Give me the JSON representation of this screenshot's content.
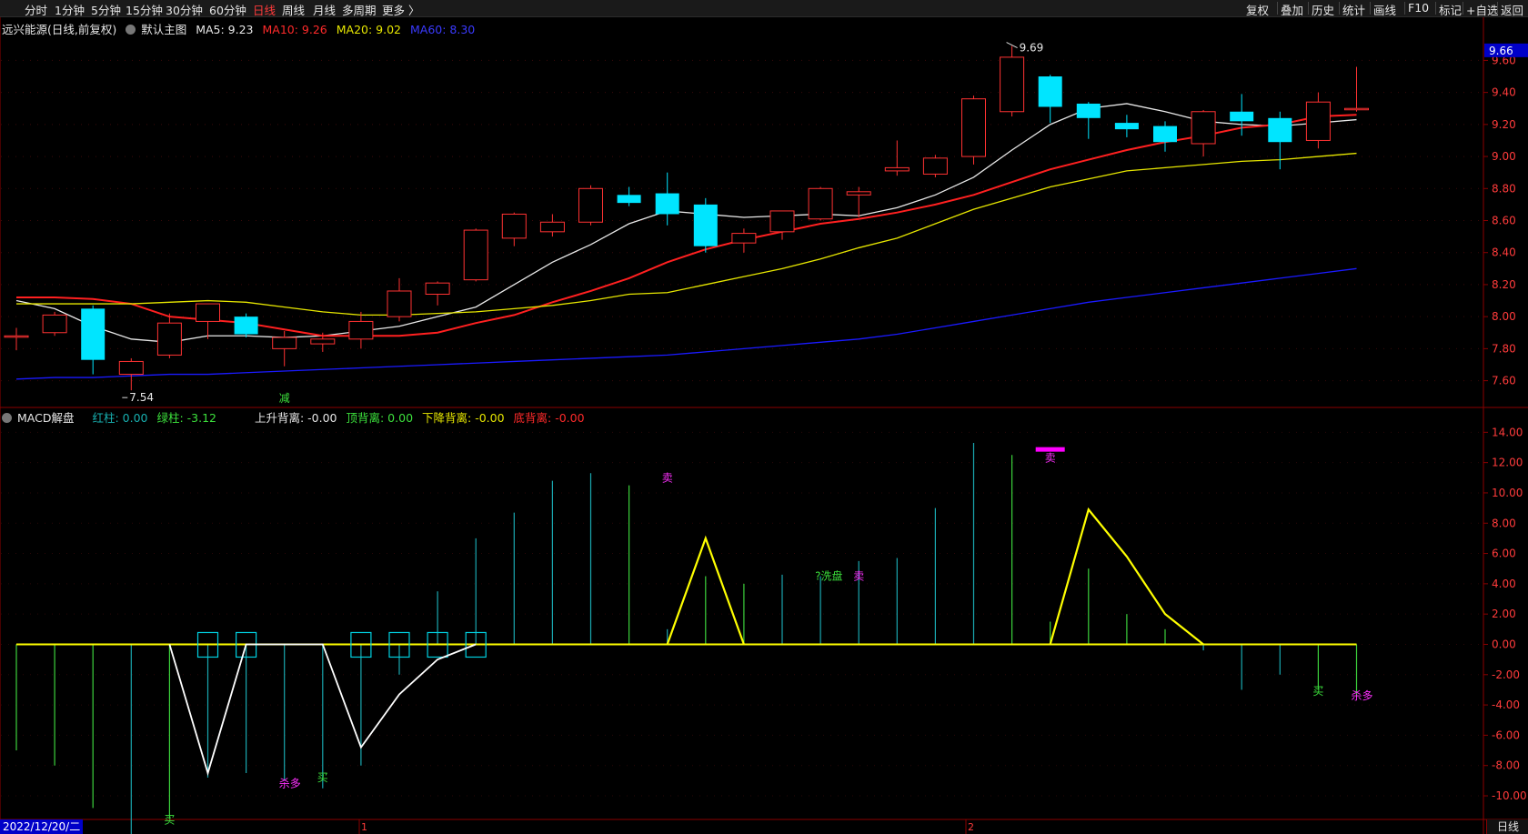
{
  "toolbar": {
    "left_items": [
      "分时",
      "1分钟",
      "5分钟",
      "15分钟",
      "30分钟",
      "60分钟",
      "日线",
      "周线",
      "月线",
      "多周期",
      "更多 〉"
    ],
    "active": "日线",
    "right_items": [
      "复权",
      "叠加",
      "历史",
      "统计",
      "画线",
      "F10",
      "标记",
      "+自选",
      "返回"
    ]
  },
  "main_panel": {
    "stock_title": "远兴能源(日线,前复权)",
    "chart_name": "默认主图",
    "ma5": "MA5: 9.23",
    "ma10": "MA10: 9.26",
    "ma20": "MA20: 9.02",
    "ma60": "MA60: 8.30",
    "price_tag": "9.66",
    "high_label": "9.69",
    "low_label": "7.54",
    "reduce_label": "减",
    "y_ticks": [
      "9.60",
      "9.40",
      "9.20",
      "9.00",
      "8.80",
      "8.60",
      "8.40",
      "8.20",
      "8.00",
      "7.80",
      "7.60"
    ]
  },
  "sub_panel": {
    "name": "MACD解盘",
    "red_bar": "红柱: 0.00",
    "green_bar": "绿柱: -3.12",
    "rise_div": "上升背离: -0.00",
    "top_div": "顶背离: 0.00",
    "fall_div": "下降背离: -0.00",
    "bottom_div": "底背离: -0.00",
    "y_ticks": [
      "14.00",
      "12.00",
      "10.00",
      "8.00",
      "6.00",
      "4.00",
      "2.00",
      "0.00",
      "-2.00",
      "-4.00",
      "-6.00",
      "-8.00",
      "-10.00"
    ],
    "signals": [
      "买",
      "杀多",
      "买",
      "卖",
      "?洗盘",
      "卖",
      "卖",
      "买",
      "杀多"
    ]
  },
  "x_axis": {
    "date": "2022/12/20/二",
    "marks": [
      "1",
      "2"
    ]
  },
  "period_label": "日线",
  "chart_data": [
    {
      "type": "candlestick",
      "title": "远兴能源(日线,前复权)",
      "ylim": [
        7.45,
        9.75
      ],
      "candles": [
        {
          "o": 7.88,
          "h": 7.93,
          "l": 7.79,
          "c": 7.88
        },
        {
          "o": 7.9,
          "h": 8.03,
          "l": 7.88,
          "c": 8.01
        },
        {
          "o": 8.05,
          "h": 8.07,
          "l": 7.64,
          "c": 7.73
        },
        {
          "o": 7.64,
          "h": 7.74,
          "l": 7.54,
          "c": 7.72
        },
        {
          "o": 7.76,
          "h": 8.02,
          "l": 7.74,
          "c": 7.96
        },
        {
          "o": 7.97,
          "h": 8.06,
          "l": 7.86,
          "c": 8.08
        },
        {
          "o": 8.0,
          "h": 8.02,
          "l": 7.87,
          "c": 7.89
        },
        {
          "o": 7.8,
          "h": 7.91,
          "l": 7.69,
          "c": 7.87
        },
        {
          "o": 7.83,
          "h": 7.9,
          "l": 7.78,
          "c": 7.86
        },
        {
          "o": 7.86,
          "h": 8.03,
          "l": 7.8,
          "c": 7.97
        },
        {
          "o": 8.0,
          "h": 8.24,
          "l": 7.97,
          "c": 8.16
        },
        {
          "o": 8.14,
          "h": 8.22,
          "l": 8.07,
          "c": 8.21
        },
        {
          "o": 8.23,
          "h": 8.55,
          "l": 8.22,
          "c": 8.54
        },
        {
          "o": 8.49,
          "h": 8.65,
          "l": 8.44,
          "c": 8.64
        },
        {
          "o": 8.53,
          "h": 8.64,
          "l": 8.5,
          "c": 8.59
        },
        {
          "o": 8.59,
          "h": 8.82,
          "l": 8.57,
          "c": 8.8
        },
        {
          "o": 8.76,
          "h": 8.81,
          "l": 8.69,
          "c": 8.71
        },
        {
          "o": 8.77,
          "h": 8.9,
          "l": 8.57,
          "c": 8.64
        },
        {
          "o": 8.7,
          "h": 8.74,
          "l": 8.4,
          "c": 8.44
        },
        {
          "o": 8.46,
          "h": 8.55,
          "l": 8.4,
          "c": 8.52
        },
        {
          "o": 8.53,
          "h": 8.66,
          "l": 8.48,
          "c": 8.66
        },
        {
          "o": 8.61,
          "h": 8.81,
          "l": 8.6,
          "c": 8.8
        },
        {
          "o": 8.76,
          "h": 8.81,
          "l": 8.62,
          "c": 8.78
        },
        {
          "o": 8.91,
          "h": 9.1,
          "l": 8.88,
          "c": 8.93
        },
        {
          "o": 8.89,
          "h": 9.01,
          "l": 8.87,
          "c": 8.99
        },
        {
          "o": 9.0,
          "h": 9.38,
          "l": 8.95,
          "c": 9.36
        },
        {
          "o": 9.28,
          "h": 9.69,
          "l": 9.25,
          "c": 9.62
        },
        {
          "o": 9.5,
          "h": 9.51,
          "l": 9.21,
          "c": 9.31
        },
        {
          "o": 9.33,
          "h": 9.34,
          "l": 9.11,
          "c": 9.24
        },
        {
          "o": 9.21,
          "h": 9.26,
          "l": 9.12,
          "c": 9.17
        },
        {
          "o": 9.19,
          "h": 9.22,
          "l": 9.03,
          "c": 9.09
        },
        {
          "o": 9.08,
          "h": 9.29,
          "l": 9.0,
          "c": 9.28
        },
        {
          "o": 9.28,
          "h": 9.39,
          "l": 9.13,
          "c": 9.22
        },
        {
          "o": 9.24,
          "h": 9.28,
          "l": 8.92,
          "c": 9.09
        },
        {
          "o": 9.1,
          "h": 9.4,
          "l": 9.05,
          "c": 9.34
        },
        {
          "o": 9.3,
          "h": 9.56,
          "l": 9.28,
          "c": 9.3
        }
      ],
      "series": [
        {
          "name": "MA5",
          "color": "#e8e8e8",
          "values": [
            8.1,
            8.05,
            7.94,
            7.86,
            7.84,
            7.88,
            7.88,
            7.87,
            7.88,
            7.91,
            7.94,
            8.0,
            8.06,
            8.2,
            8.34,
            8.45,
            8.58,
            8.66,
            8.64,
            8.62,
            8.63,
            8.64,
            8.63,
            8.68,
            8.76,
            8.87,
            9.04,
            9.2,
            9.3,
            9.33,
            9.28,
            9.22,
            9.2,
            9.19,
            9.21,
            9.23
          ]
        },
        {
          "name": "MA10",
          "color": "#ff2020",
          "values": [
            8.12,
            8.12,
            8.11,
            8.08,
            8.0,
            7.98,
            7.96,
            7.92,
            7.88,
            7.88,
            7.88,
            7.9,
            7.96,
            8.01,
            8.09,
            8.16,
            8.24,
            8.34,
            8.42,
            8.48,
            8.53,
            8.58,
            8.61,
            8.65,
            8.7,
            8.76,
            8.84,
            8.92,
            8.98,
            9.04,
            9.09,
            9.13,
            9.18,
            9.2,
            9.25,
            9.26
          ]
        },
        {
          "name": "MA20",
          "color": "#e6e600",
          "values": [
            8.08,
            8.08,
            8.08,
            8.08,
            8.09,
            8.1,
            8.09,
            8.06,
            8.03,
            8.01,
            8.01,
            8.02,
            8.03,
            8.05,
            8.07,
            8.1,
            8.14,
            8.15,
            8.2,
            8.25,
            8.3,
            8.36,
            8.43,
            8.49,
            8.58,
            8.67,
            8.74,
            8.81,
            8.86,
            8.91,
            8.93,
            8.95,
            8.97,
            8.98,
            9.0,
            9.02
          ]
        },
        {
          "name": "MA60",
          "color": "#1a1aff",
          "values": [
            7.61,
            7.62,
            7.62,
            7.63,
            7.64,
            7.64,
            7.65,
            7.66,
            7.67,
            7.68,
            7.69,
            7.7,
            7.71,
            7.72,
            7.73,
            7.74,
            7.75,
            7.76,
            7.78,
            7.8,
            7.82,
            7.84,
            7.86,
            7.89,
            7.93,
            7.97,
            8.01,
            8.05,
            8.09,
            8.12,
            8.15,
            8.18,
            8.21,
            8.24,
            8.27,
            8.3
          ]
        }
      ]
    },
    {
      "type": "bar",
      "title": "MACD解盘",
      "ylim": [
        -11.5,
        14.5
      ],
      "bars": [
        -7.0,
        -8.0,
        -10.8,
        -13.0,
        -11.5,
        -8.8,
        -8.5,
        -9.0,
        -9.5,
        -8.0,
        -2.0,
        3.5,
        7.0,
        8.7,
        10.8,
        11.3,
        10.5,
        1.0,
        4.5,
        4.0,
        4.6,
        4.5,
        5.5,
        5.7,
        9.0,
        13.3,
        12.5,
        1.5,
        5.0,
        2.0,
        1.0,
        -0.4,
        -3.0,
        -2.0,
        -3.0,
        -3.5
      ],
      "bar_colors_teal_index": [
        3,
        5,
        6,
        7,
        8,
        9,
        10,
        11,
        12,
        13,
        14,
        15,
        17,
        20,
        21,
        22,
        23,
        24,
        25,
        31,
        32,
        33
      ],
      "white_line": [
        {
          "i": 4,
          "v": 0
        },
        {
          "i": 5,
          "v": -8.5
        },
        {
          "i": 6,
          "v": 0
        },
        {
          "i": 8,
          "v": 0
        },
        {
          "i": 9,
          "v": -6.8
        },
        {
          "i": 10,
          "v": -3.3
        },
        {
          "i": 11,
          "v": -1.0
        },
        {
          "i": 12,
          "v": 0
        }
      ],
      "yellow_line": [
        {
          "i": 17,
          "v": 0
        },
        {
          "i": 18,
          "v": 7.0
        },
        {
          "i": 19,
          "v": 0
        },
        {
          "i": 27,
          "v": 0
        },
        {
          "i": 28,
          "v": 8.9
        },
        {
          "i": 29,
          "v": 5.8
        },
        {
          "i": 30,
          "v": 2.0
        },
        {
          "i": 31,
          "v": 0
        }
      ],
      "box_indices": [
        5,
        6,
        9,
        10,
        11,
        12
      ],
      "magenta_bar_index": 27
    }
  ]
}
